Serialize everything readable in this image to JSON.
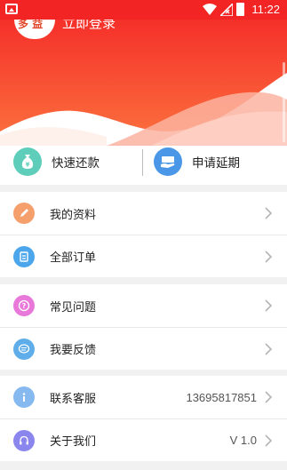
{
  "status_bar": {
    "time": "11:22"
  },
  "header": {
    "login_text": "立即登录",
    "gradient_top": "#f5302a",
    "gradient_bottom": "#fb6b3c"
  },
  "quick_actions": [
    {
      "label": "快速还款",
      "icon": "money-bag-icon",
      "color": "#5ecdb9"
    },
    {
      "label": "申请延期",
      "icon": "calendar-hand-icon",
      "color": "#4a97e8"
    }
  ],
  "menu_groups": [
    {
      "items": [
        {
          "label": "我的资料",
          "icon": "pencil-icon",
          "color": "#f59f6c"
        },
        {
          "label": "全部订单",
          "icon": "clipboard-icon",
          "color": "#4ba6ec"
        }
      ]
    },
    {
      "items": [
        {
          "label": "常见问题",
          "icon": "question-icon",
          "color": "#e879da"
        },
        {
          "label": "我要反馈",
          "icon": "chat-bubble-icon",
          "color": "#5faee9"
        }
      ]
    },
    {
      "items": [
        {
          "label": "联系客服",
          "icon": "info-icon",
          "color": "#86b9f0",
          "value": "13695817851"
        },
        {
          "label": "关于我们",
          "icon": "headset-icon",
          "color": "#8a86ee",
          "value": "V 1.0"
        }
      ]
    }
  ]
}
